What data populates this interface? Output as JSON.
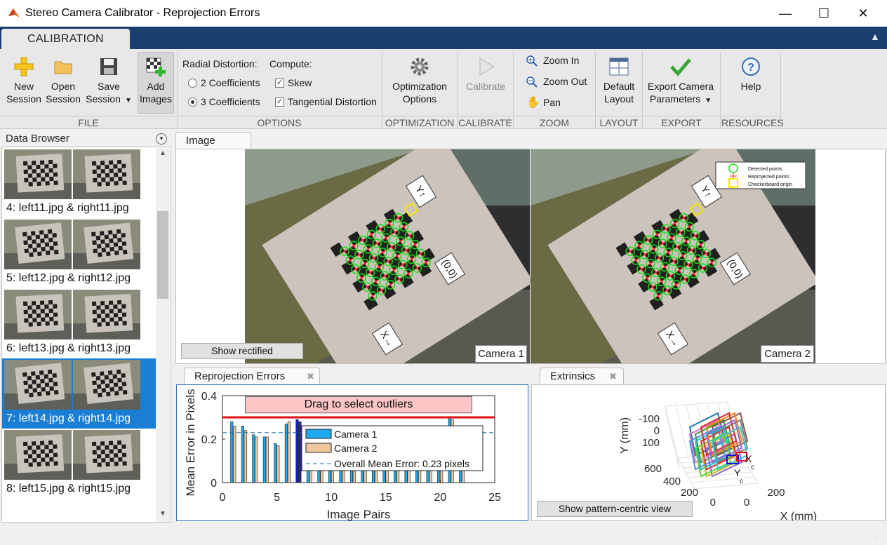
{
  "window": {
    "title": "Stereo Camera Calibrator - Reprojection Errors"
  },
  "ribbon": {
    "tab": "CALIBRATION",
    "file": {
      "new": [
        "New",
        "Session"
      ],
      "open": [
        "Open",
        "Session"
      ],
      "save": [
        "Save",
        "Session"
      ],
      "add": [
        "Add",
        "Images"
      ],
      "section": "FILE"
    },
    "options": {
      "radial_label": "Radial Distortion:",
      "two_coeff": "2 Coefficients",
      "three_coeff": "3 Coefficients",
      "selected": "3 Coefficients",
      "compute_label": "Compute:",
      "skew": "Skew",
      "tangential": "Tangential Distortion",
      "section": "OPTIONS"
    },
    "optimization": {
      "button": [
        "Optimization",
        "Options"
      ],
      "section": "OPTIMIZATION"
    },
    "calibrate": {
      "button": "Calibrate",
      "section": "CALIBRATE"
    },
    "zoom": {
      "in": "Zoom In",
      "out": "Zoom Out",
      "pan": "Pan",
      "section": "ZOOM"
    },
    "layout": {
      "button": [
        "Default",
        "Layout"
      ],
      "section": "LAYOUT"
    },
    "export": {
      "button": [
        "Export Camera",
        "Parameters"
      ],
      "section": "EXPORT"
    },
    "resources": {
      "button": "Help",
      "section": "RESOURCES"
    }
  },
  "browser": {
    "title": "Data Browser",
    "items": [
      {
        "label": "4: left11.jpg & right11.jpg",
        "selected": false
      },
      {
        "label": "5: left12.jpg & right12.jpg",
        "selected": false
      },
      {
        "label": "6: left13.jpg & right13.jpg",
        "selected": false
      },
      {
        "label": "7: left14.jpg & right14.jpg",
        "selected": true
      },
      {
        "label": "8: left15.jpg & right15.jpg",
        "selected": false
      }
    ]
  },
  "image_panel": {
    "tab": "Image",
    "show_rectified": "Show rectified",
    "camera1": "Camera 1",
    "camera2": "Camera 2",
    "legend": [
      "Detected points",
      "Reprojected points",
      "Checkerboard origin"
    ],
    "axis_y": "Y↑",
    "axis_x": "X→",
    "origin": "(0,0)"
  },
  "reproj_panel": {
    "tab": "Reprojection Errors",
    "outlier_label": "Drag to select outliers"
  },
  "extrinsics_panel": {
    "tab": "Extrinsics",
    "button": "Show pattern-centric view",
    "ylabel": "Y (mm)",
    "xlabel": "X (mm)",
    "y_ticks": [
      "-100",
      "0",
      "100"
    ],
    "z_ticks": [
      "600",
      "400",
      "200",
      "0"
    ],
    "x_ticks": [
      "0",
      "200"
    ]
  },
  "chart_data": {
    "type": "bar",
    "xlabel": "Image Pairs",
    "ylabel": "Mean Error in Pixels",
    "xlim": [
      0,
      25
    ],
    "ylim": [
      0,
      0.4
    ],
    "x_ticks": [
      0,
      5,
      10,
      15,
      20,
      25
    ],
    "y_ticks": [
      0,
      0.2,
      0.4
    ],
    "categories": [
      1,
      2,
      3,
      4,
      5,
      6,
      7,
      8,
      9,
      10,
      11,
      12,
      13,
      14,
      15,
      16,
      17,
      18,
      19,
      20,
      21,
      22
    ],
    "series": [
      {
        "name": "Camera 1",
        "color": "#1ea9f0",
        "values": [
          0.28,
          0.26,
          0.22,
          0.21,
          0.18,
          0.27,
          0.29,
          0.26,
          0.24,
          0.22,
          0.22,
          0.24,
          0.25,
          0.22,
          0.21,
          0.23,
          0.23,
          0.24,
          0.26,
          0.25,
          0.3,
          0.22
        ]
      },
      {
        "name": "Camera 2",
        "color": "#f0c8a0",
        "values": [
          0.26,
          0.24,
          0.21,
          0.21,
          0.17,
          0.28,
          0.28,
          0.25,
          0.23,
          0.22,
          0.21,
          0.23,
          0.24,
          0.21,
          0.21,
          0.22,
          0.22,
          0.23,
          0.25,
          0.24,
          0.29,
          0.21
        ]
      }
    ],
    "selected_pair": 7,
    "overall_mean": 0.23,
    "overall_mean_label": "Overall Mean Error: 0.23 pixels",
    "threshold": 0.3,
    "legend_placement": "center-right"
  }
}
